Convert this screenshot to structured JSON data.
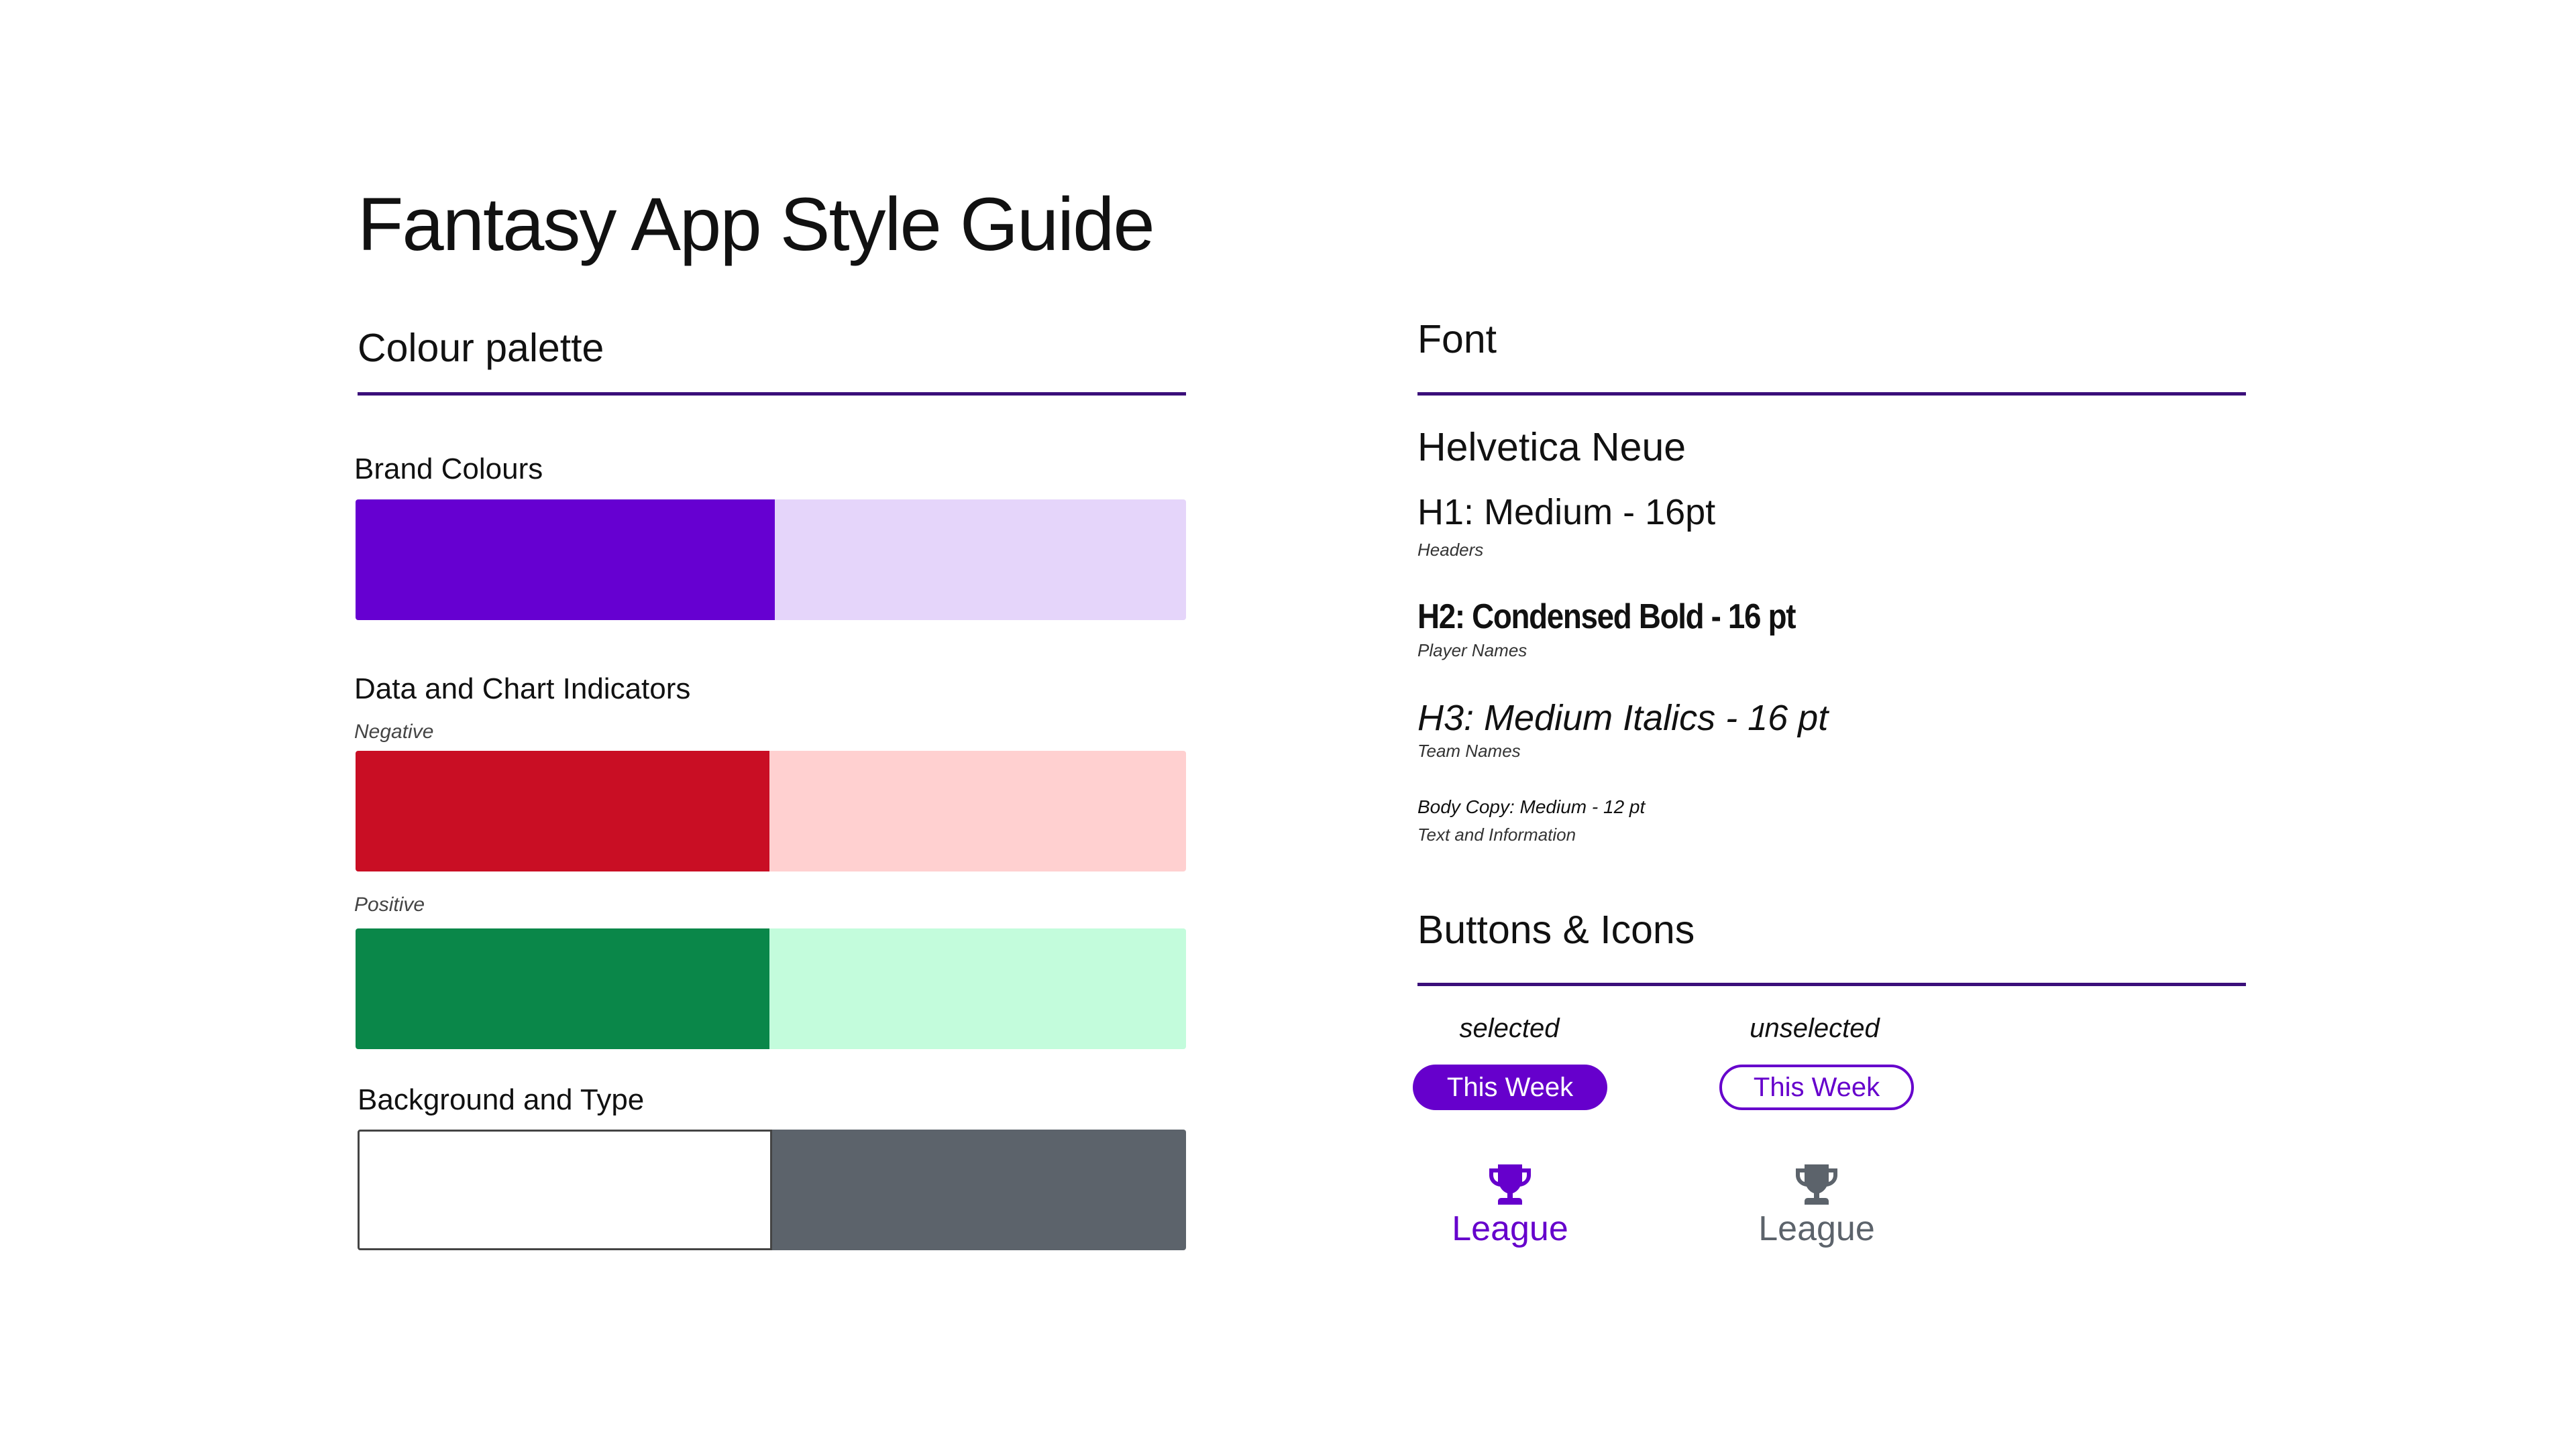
{
  "title": "Fantasy App Style Guide",
  "colour_palette": {
    "heading": "Colour palette",
    "brand": {
      "label": "Brand Colours",
      "colors": [
        "#6600d1",
        "#e5d5fa"
      ]
    },
    "indicators": {
      "label": "Data and Chart Indicators",
      "negative": {
        "label": "Negative",
        "colors": [
          "#c90e24",
          "#ffd0d0"
        ]
      },
      "positive": {
        "label": "Positive",
        "colors": [
          "#0a8749",
          "#c3fcdc"
        ]
      }
    },
    "background_type": {
      "label": "Background and Type",
      "colors": [
        "#ffffff",
        "#5c636b"
      ]
    }
  },
  "font": {
    "heading": "Font",
    "family": "Helvetica Neue",
    "h1": {
      "label": "H1: Medium - 16pt",
      "usage": "Headers"
    },
    "h2": {
      "label": "H2: Condensed Bold - 16 pt",
      "usage": "Player Names"
    },
    "h3": {
      "label": "H3:  Medium Italics - 16 pt",
      "usage": "Team Names"
    },
    "body": {
      "label": "Body Copy:  Medium  - 12 pt",
      "usage": "Text and Information"
    }
  },
  "buttons_icons": {
    "heading": "Buttons & Icons",
    "selected_label": "selected",
    "unselected_label": "unselected",
    "button_text": "This Week",
    "icon_name": "trophy-icon",
    "nav_label": "League",
    "selected_color": "#6600cc",
    "unselected_color": "#5c636b"
  }
}
